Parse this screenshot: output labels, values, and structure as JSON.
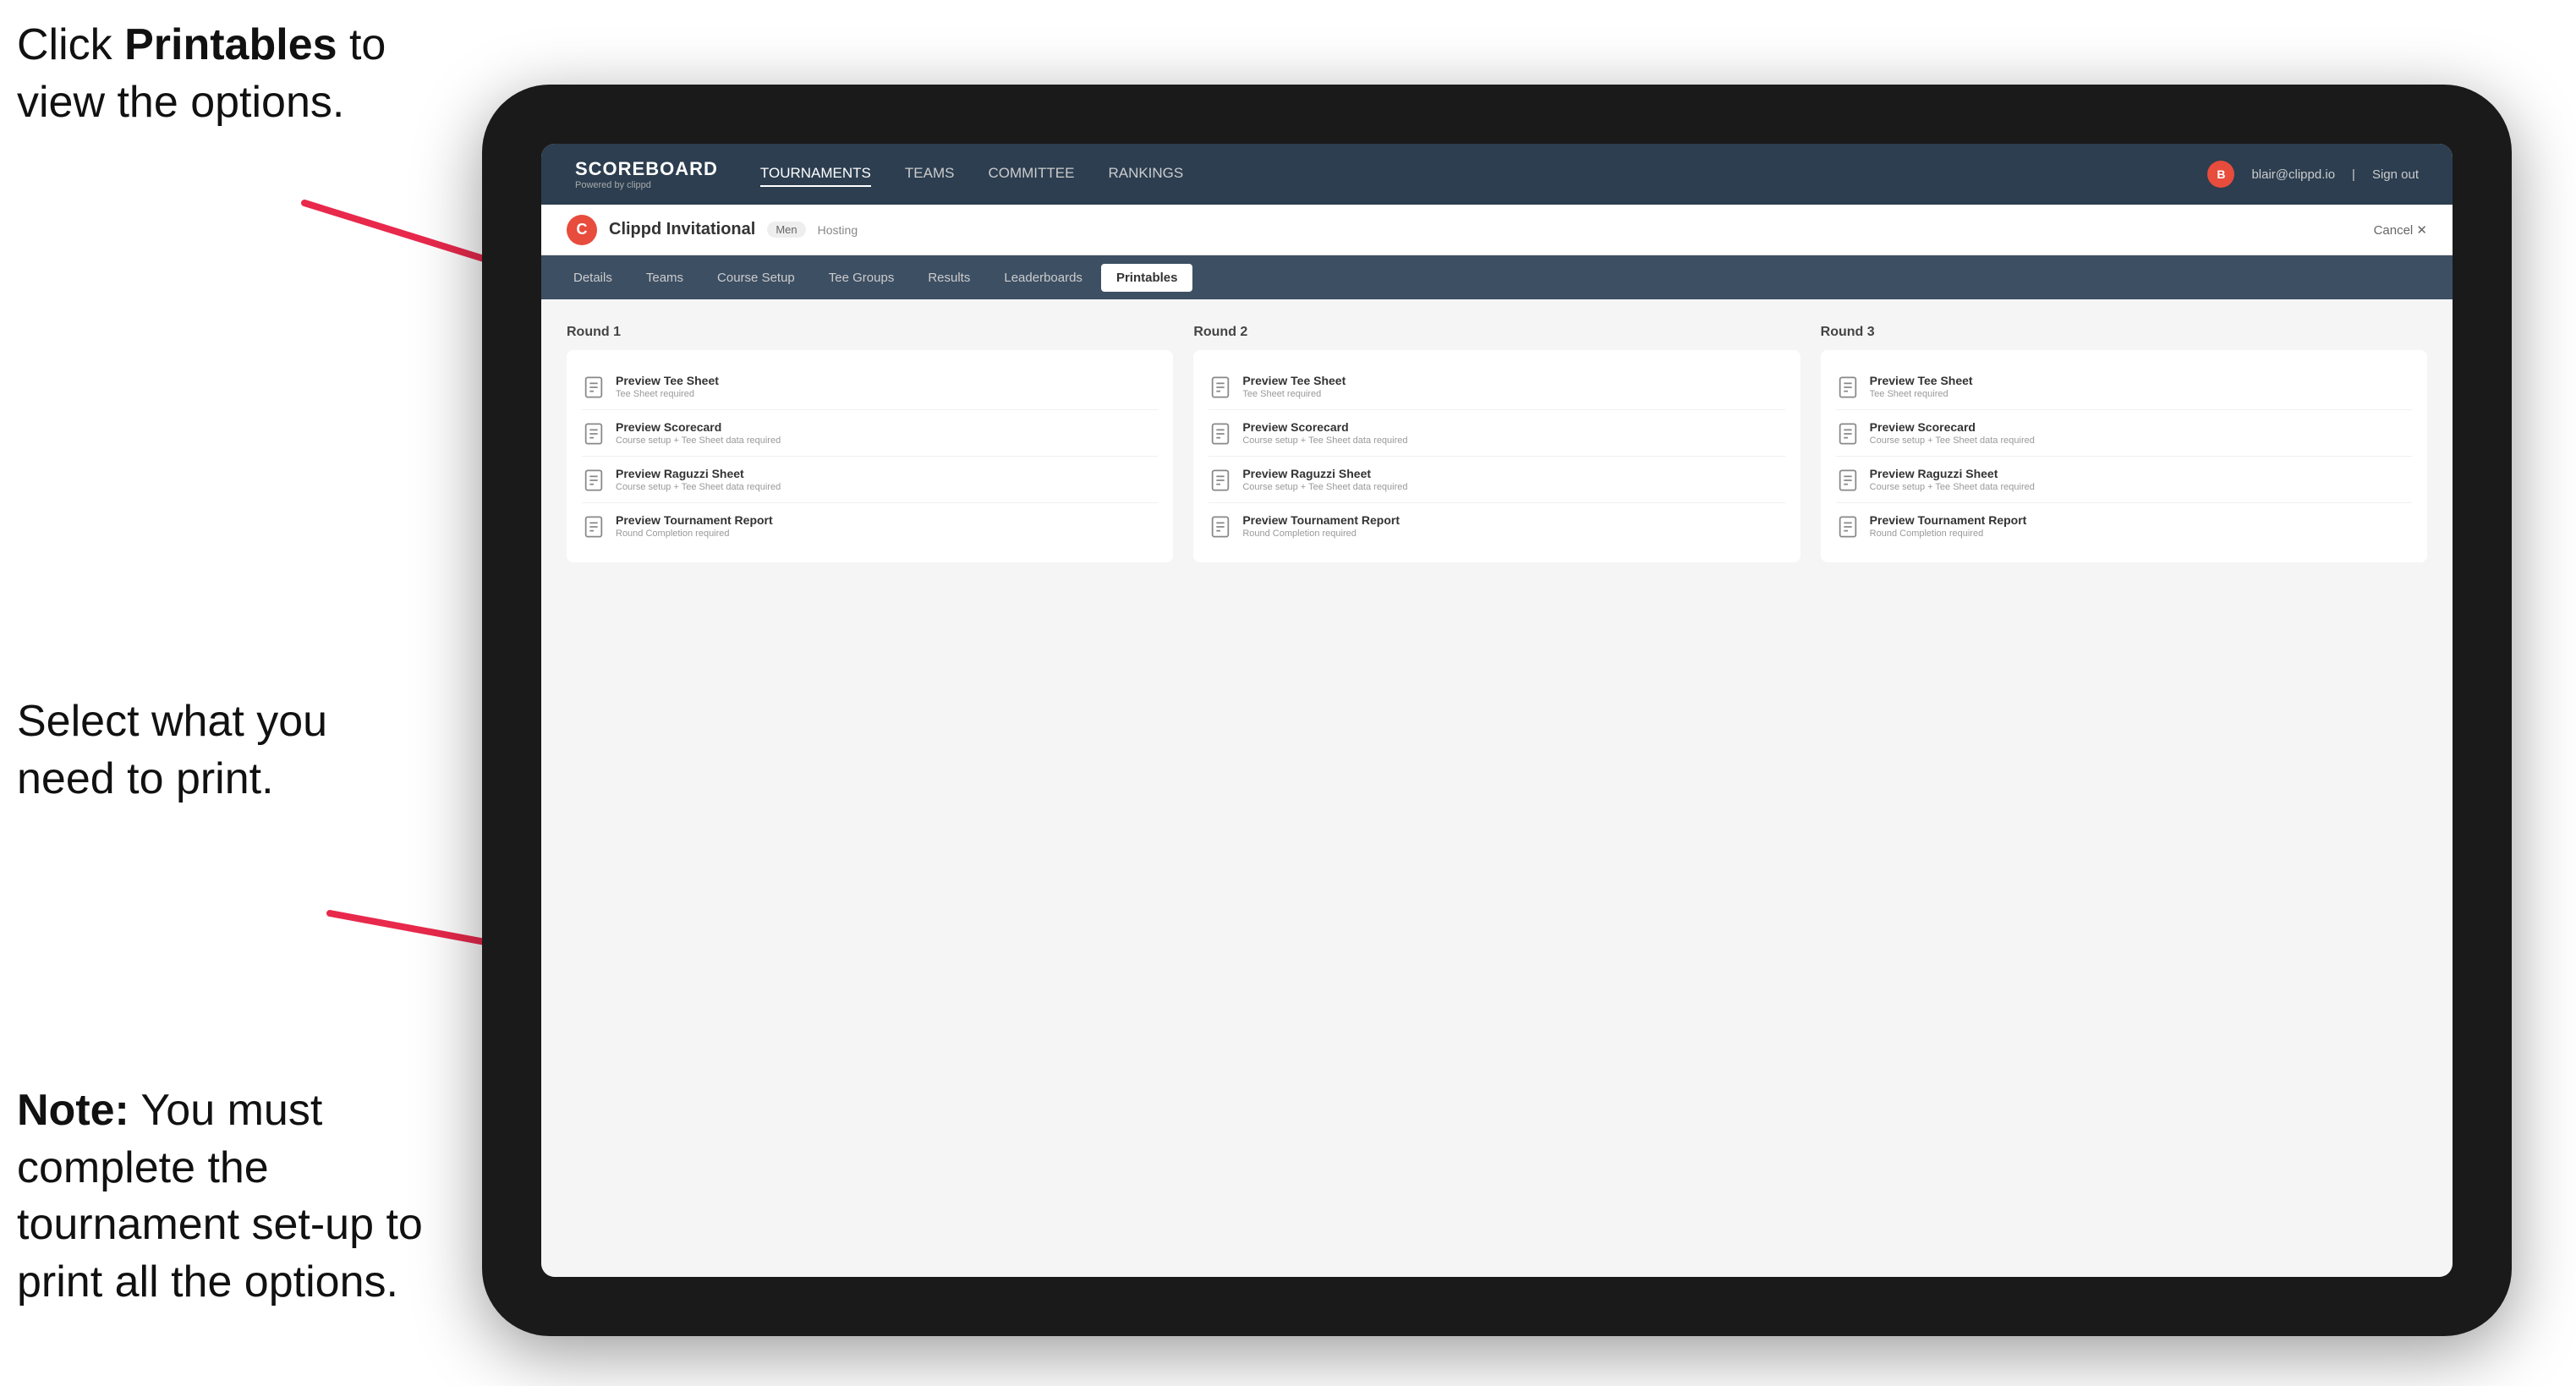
{
  "annotations": {
    "top_instruction": "Click ",
    "top_bold": "Printables",
    "top_suffix": " to view the options.",
    "middle_instruction": "Select what you need to print.",
    "bottom_note": "Note:",
    "bottom_suffix": " You must complete the tournament set-up to print all the options."
  },
  "topNav": {
    "logo_title": "SCOREBOARD",
    "logo_subtitle": "Powered by clippd",
    "links": [
      "TOURNAMENTS",
      "TEAMS",
      "COMMITTEE",
      "RANKINGS"
    ],
    "active_link": "TOURNAMENTS",
    "user_email": "blair@clippd.io",
    "sign_out": "Sign out"
  },
  "tournamentHeader": {
    "logo_letter": "C",
    "name": "Clippd Invitational",
    "category": "Men",
    "status": "Hosting",
    "cancel": "Cancel ✕"
  },
  "tabs": {
    "items": [
      "Details",
      "Teams",
      "Course Setup",
      "Tee Groups",
      "Results",
      "Leaderboards",
      "Printables"
    ],
    "active": "Printables"
  },
  "rounds": [
    {
      "title": "Round 1",
      "items": [
        {
          "title": "Preview Tee Sheet",
          "sub": "Tee Sheet required"
        },
        {
          "title": "Preview Scorecard",
          "sub": "Course setup + Tee Sheet data required"
        },
        {
          "title": "Preview Raguzzi Sheet",
          "sub": "Course setup + Tee Sheet data required"
        },
        {
          "title": "Preview Tournament Report",
          "sub": "Round Completion required"
        }
      ]
    },
    {
      "title": "Round 2",
      "items": [
        {
          "title": "Preview Tee Sheet",
          "sub": "Tee Sheet required"
        },
        {
          "title": "Preview Scorecard",
          "sub": "Course setup + Tee Sheet data required"
        },
        {
          "title": "Preview Raguzzi Sheet",
          "sub": "Course setup + Tee Sheet data required"
        },
        {
          "title": "Preview Tournament Report",
          "sub": "Round Completion required"
        }
      ]
    },
    {
      "title": "Round 3",
      "items": [
        {
          "title": "Preview Tee Sheet",
          "sub": "Tee Sheet required"
        },
        {
          "title": "Preview Scorecard",
          "sub": "Course setup + Tee Sheet data required"
        },
        {
          "title": "Preview Raguzzi Sheet",
          "sub": "Course setup + Tee Sheet data required"
        },
        {
          "title": "Preview Tournament Report",
          "sub": "Round Completion required"
        }
      ]
    }
  ]
}
